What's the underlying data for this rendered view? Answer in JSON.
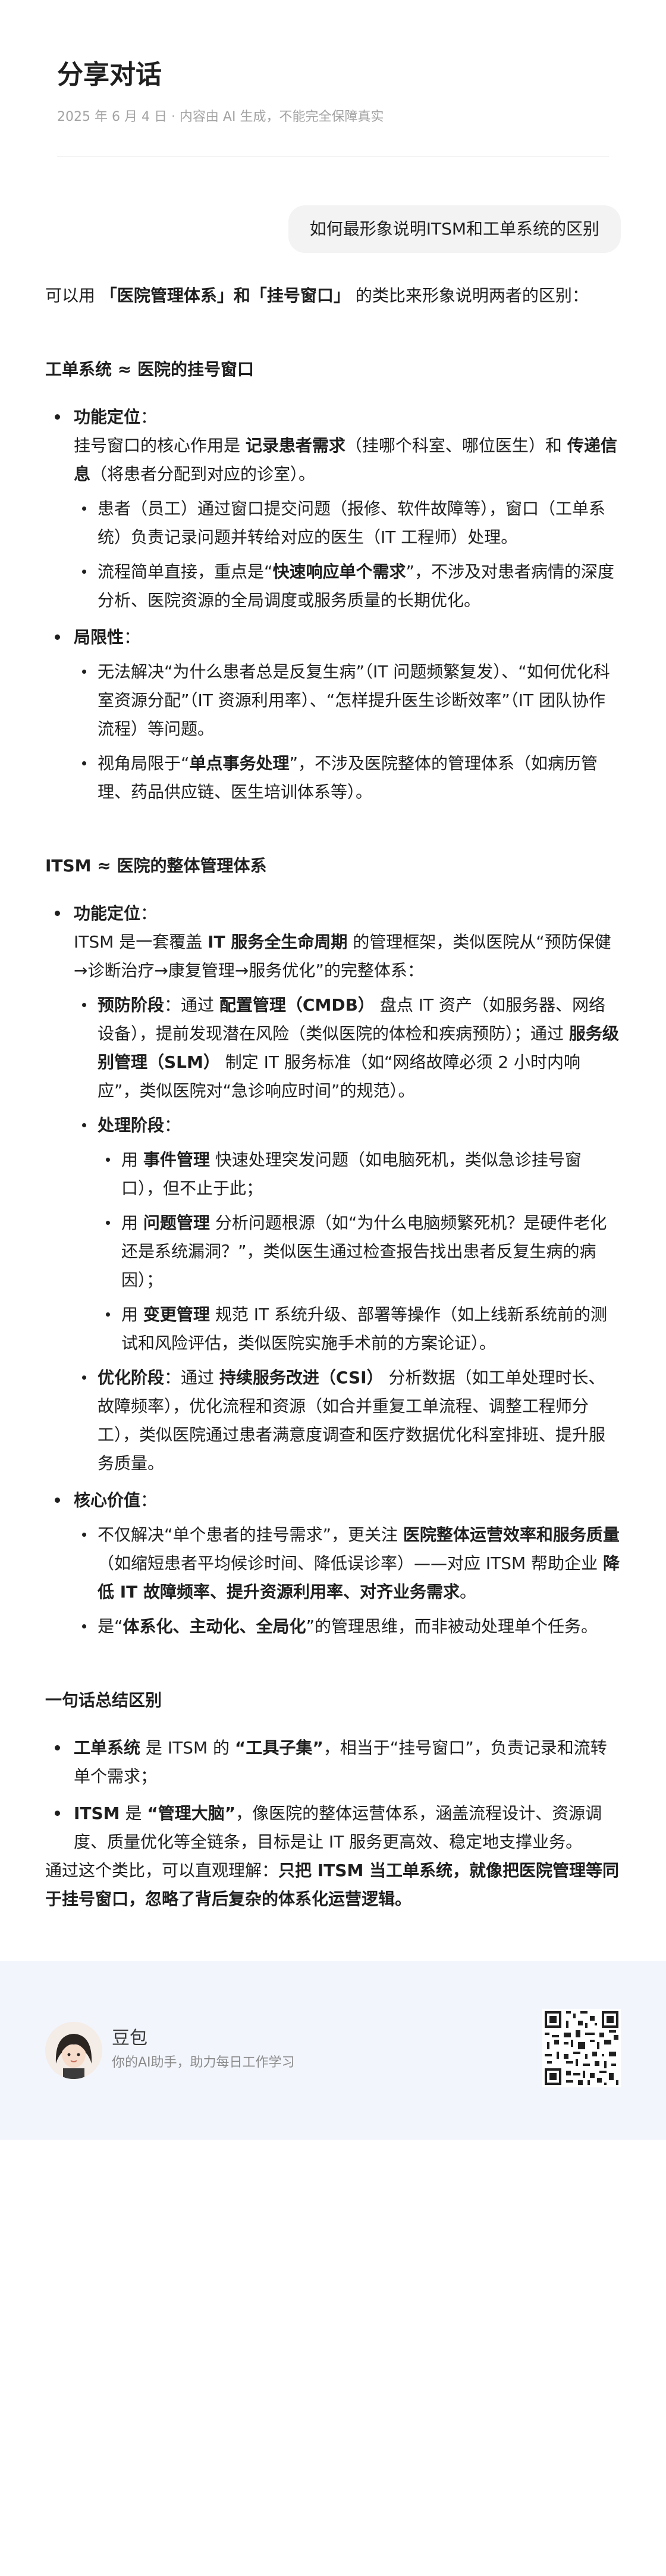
{
  "header": {
    "title": "分享对话",
    "meta": "2025 年 6 月 4 日 · 内容由 AI 生成，不能完全保障真实"
  },
  "user_message": "如何最形象说明ITSM和工单系统的区别",
  "intro": {
    "pre": "可以用 ",
    "bold": "「医院管理体系」和「挂号窗口」",
    "post": " 的类比来形象说明两者的区别："
  },
  "section1": {
    "heading": "工单系统 ≈ 医院的挂号窗口",
    "func_label": "功能定位",
    "func_p": {
      "t1": "挂号窗口的核心作用是 ",
      "b1": "记录患者需求",
      "t2": "（挂哪个科室、哪位医生）和 ",
      "b2": "传递信息",
      "t3": "（将患者分配到对应的诊室）。"
    },
    "func_items": [
      "患者（员工）通过窗口提交问题（报修、软件故障等），窗口（工单系统）负责记录问题并转给对应的医生（IT 工程师）处理。",
      {
        "t1": "流程简单直接，重点是“",
        "b1": "快速响应单个需求",
        "t2": "”，不涉及对患者病情的深度分析、医院资源的全局调度或服务质量的长期优化。"
      }
    ],
    "limit_label": "局限性",
    "limit_items": [
      "无法解决“为什么患者总是反复生病”（IT 问题频繁复发）、“如何优化科室资源分配”（IT 资源利用率）、“怎样提升医生诊断效率”（IT 团队协作流程）等问题。",
      {
        "t1": "视角局限于“",
        "b1": "单点事务处理",
        "t2": "”，不涉及医院整体的管理体系（如病历管理、药品供应链、医生培训体系等）。"
      }
    ]
  },
  "section2": {
    "heading": "ITSM ≈ 医院的整体管理体系",
    "func_label": "功能定位",
    "func_p": {
      "t1": "ITSM 是一套覆盖 ",
      "b1": "IT 服务全生命周期",
      "t2": " 的管理框架，类似医院从“预防保健→诊断治疗→康复管理→服务优化”的完整体系："
    },
    "prevent": {
      "label": "预防阶段",
      "t1": "：通过 ",
      "b1": "配置管理（CMDB）",
      "t2": " 盘点 IT 资产（如服务器、网络设备），提前发现潜在风险（类似医院的体检和疾病预防）；通过 ",
      "b2": "服务级别管理（SLM）",
      "t3": " 制定 IT 服务标准（如“网络故障必须 2 小时内响应”，类似医院对“急诊响应时间”的规范）。"
    },
    "process_label": "处理阶段",
    "process_items": [
      {
        "t1": "用 ",
        "b1": "事件管理",
        "t2": " 快速处理突发问题（如电脑死机，类似急诊挂号窗口），但不止于此；"
      },
      {
        "t1": "用 ",
        "b1": "问题管理",
        "t2": " 分析问题根源（如“为什么电脑频繁死机？是硬件老化还是系统漏洞？”，类似医生通过检查报告找出患者反复生病的病因）；"
      },
      {
        "t1": "用 ",
        "b1": "变更管理",
        "t2": " 规范 IT 系统升级、部署等操作（如上线新系统前的测试和风险评估，类似医院实施手术前的方案论证）。"
      }
    ],
    "optimize": {
      "label": "优化阶段",
      "t1": "：通过 ",
      "b1": "持续服务改进（CSI）",
      "t2": " 分析数据（如工单处理时长、故障频率），优化流程和资源（如合并重复工单流程、调整工程师分工），类似医院通过患者满意度调查和医疗数据优化科室排班、提升服务质量。"
    },
    "value_label": "核心价值",
    "value_items": [
      {
        "t1": "不仅解决“单个患者的挂号需求”，更关注 ",
        "b1": "医院整体运营效率和服务质量",
        "t2": "（如缩短患者平均候诊时间、降低误诊率）——对应 ITSM 帮助企业 ",
        "b2": "降低 IT 故障频率、提升资源利用率、对齐业务需求",
        "t3": "。"
      },
      {
        "t1": "是“",
        "b1": "体系化、主动化、全局化",
        "t2": "”的管理思维，而非被动处理单个任务。"
      }
    ]
  },
  "summary": {
    "heading": "一句话总结区别",
    "items": [
      {
        "b1": "工单系统",
        "t1": " 是 ITSM 的 ",
        "b2": "“工具子集”",
        "t2": "，相当于“挂号窗口”，负责记录和流转单个需求；"
      },
      {
        "b1": "ITSM",
        "t1": " 是 ",
        "b2": "“管理大脑”",
        "t2": "，像医院的整体运营体系，涵盖流程设计、资源调度、质量优化等全链条，目标是让 IT 服务更高效、稳定地支撑业务。"
      }
    ],
    "closing_pre": "通过这个类比，可以直观理解：",
    "closing_bold": "只把 ITSM 当工单系统，就像把医院管理等同于挂号窗口，忽略了背后复杂的体系化运营逻辑。"
  },
  "footer": {
    "brand": "豆包",
    "tagline": "你的AI助手，助力每日工作学习"
  }
}
